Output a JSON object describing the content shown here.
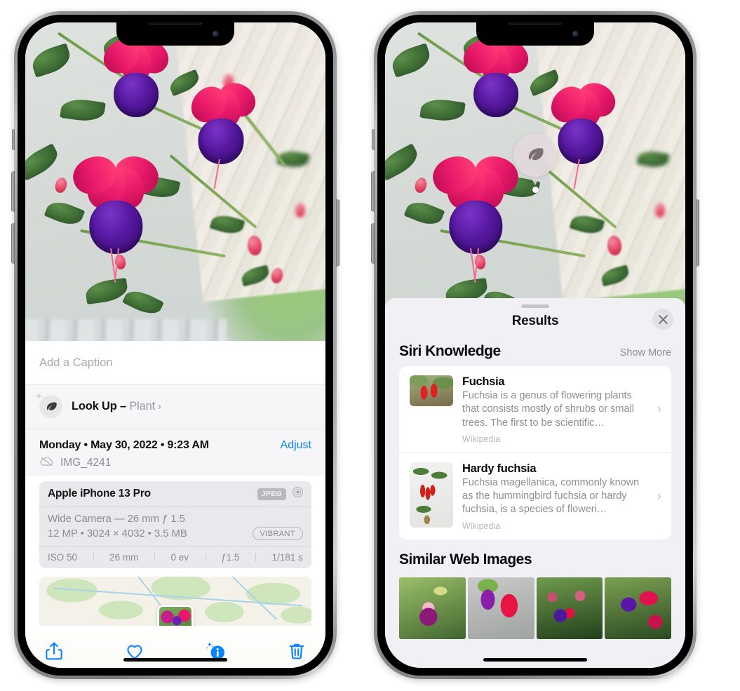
{
  "left_phone": {
    "name": "photos-detail-view",
    "photo": {
      "alt": "fuchsia-flowers-photo"
    },
    "caption_field": {
      "placeholder": "Add a Caption",
      "value": ""
    },
    "look_up": {
      "icon": "leaf-icon",
      "sparkle_icon": "sparkle-icon",
      "label": "Look Up – ",
      "subject": "Plant",
      "chevron": "›"
    },
    "meta": {
      "date": "Monday • May 30, 2022 • 9:23 AM",
      "adjust_label": "Adjust",
      "cloud_icon": "cloud-slash-icon",
      "filename": "IMG_4241"
    },
    "camera_card": {
      "model": "Apple iPhone 13 Pro",
      "format_badge": "JPEG",
      "aperture_icon": "aperture-icon",
      "lens_line": "Wide Camera — 26 mm ƒ 1.5",
      "size_line": "12 MP  •  3024 × 4032  •  3.5 MB",
      "style_badge": "VIBRANT",
      "exif": [
        "ISO 50",
        "26 mm",
        "0 ev",
        "ƒ1.5",
        "1/181 s"
      ]
    },
    "map": {
      "label": "photo-location-map"
    },
    "toolbar": [
      {
        "name": "share-icon",
        "label": "Share"
      },
      {
        "name": "favorite-heart-icon",
        "label": "Favorite"
      },
      {
        "name": "info-sparkle-icon",
        "label": "Info"
      },
      {
        "name": "trash-icon",
        "label": "Delete"
      }
    ]
  },
  "right_phone": {
    "name": "visual-look-up-results-view",
    "badge": {
      "icon": "leaf-icon",
      "label": "visual-look-up-badge"
    },
    "sheet": {
      "grabber": "sheet-grabber",
      "title": "Results",
      "close_icon": "close-icon",
      "sections": [
        {
          "title": "Siri Knowledge",
          "action": "Show More",
          "items": [
            {
              "title": "Fuchsia",
              "desc": "Fuchsia is a genus of flowering plants that consists mostly of shrubs or small trees. The first to be scientific…",
              "source": "Wikipedia",
              "thumb": "fuchsia-red-flowers-thumbnail",
              "chevron": "›"
            },
            {
              "title": "Hardy fuchsia",
              "desc": "Fuchsia magellanica, commonly known as the hummingbird fuchsia or hardy fuchsia, is a species of floweri…",
              "source": "Wikipedia",
              "thumb": "hardy-fuchsia-branch-thumbnail",
              "chevron": "›"
            }
          ]
        },
        {
          "title": "Similar Web Images",
          "images": [
            {
              "name": "web-image-1"
            },
            {
              "name": "web-image-2"
            },
            {
              "name": "web-image-3"
            },
            {
              "name": "web-image-4"
            }
          ]
        }
      ]
    }
  },
  "colors": {
    "accent_blue": "#0a84ff",
    "sheet_bg": "#f1f1f5",
    "card_bg": "#e9e9ed",
    "secondary_text": "#8e8e93"
  }
}
